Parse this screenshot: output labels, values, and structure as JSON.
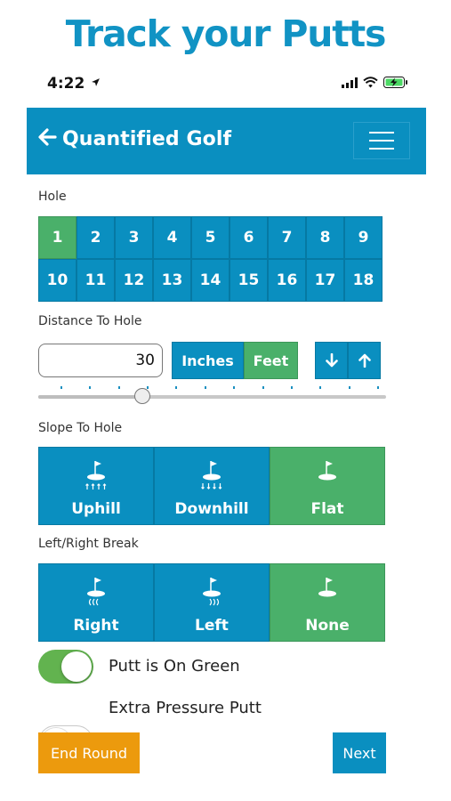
{
  "headline": "Track your Putts",
  "status_bar": {
    "time": "4:22"
  },
  "app_bar": {
    "title": "Quantified Golf"
  },
  "hole_section": {
    "label": "Hole",
    "holes": [
      "1",
      "2",
      "3",
      "4",
      "5",
      "6",
      "7",
      "8",
      "9",
      "10",
      "11",
      "12",
      "13",
      "14",
      "15",
      "16",
      "17",
      "18"
    ],
    "selected": "1"
  },
  "distance_section": {
    "label": "Distance To Hole",
    "value": "30",
    "units": [
      {
        "label": "Inches",
        "selected": false
      },
      {
        "label": "Feet",
        "selected": true
      }
    ],
    "slider_fraction": 0.3
  },
  "slope_section": {
    "label": "Slope To Hole",
    "options": [
      {
        "label": "Uphill",
        "icon": "uphill-icon"
      },
      {
        "label": "Downhill",
        "icon": "downhill-icon"
      },
      {
        "label": "Flat",
        "icon": "flat-icon"
      }
    ],
    "selected": "Flat"
  },
  "break_section": {
    "label": "Left/Right Break",
    "options": [
      {
        "label": "Right",
        "icon": "right-break-icon"
      },
      {
        "label": "Left",
        "icon": "left-break-icon"
      },
      {
        "label": "None",
        "icon": "no-break-icon"
      }
    ],
    "selected": "None"
  },
  "toggles": [
    {
      "label": "Putt is On Green",
      "on": true
    },
    {
      "label": "Extra Pressure Putt",
      "on": false
    }
  ],
  "actions": {
    "end_round": "End Round",
    "next": "Next"
  },
  "colors": {
    "primary": "#0a8fc0",
    "selected": "#4ab06a",
    "warning": "#ec9a0d",
    "headline": "#1193c4",
    "toggle_on": "#62b34f"
  }
}
